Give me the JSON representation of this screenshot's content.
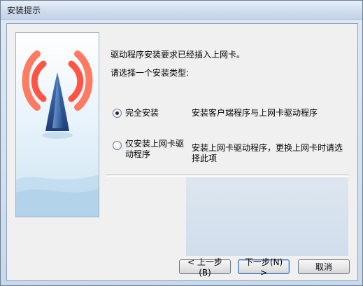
{
  "window": {
    "title": "安装提示"
  },
  "content": {
    "line1": "驱动程序安装要求已经插入上网卡。",
    "line2": "请选择一个安装类型:"
  },
  "options": [
    {
      "label": "完全安装",
      "description": "安装客户端程序与上网卡驱动程序",
      "selected": true
    },
    {
      "label": "仅安装上网卡驱动程序",
      "description": "安装上网卡驱动程序，更换上网卡时请选择此项",
      "selected": false
    }
  ],
  "buttons": {
    "back": "< 上一步(B)",
    "next": "下一步(N) >",
    "cancel": "取消"
  },
  "icons": {
    "banner": "wireless-signal-icon",
    "radio_selected": "radio-selected-icon",
    "radio_unselected": "radio-unselected-icon"
  }
}
